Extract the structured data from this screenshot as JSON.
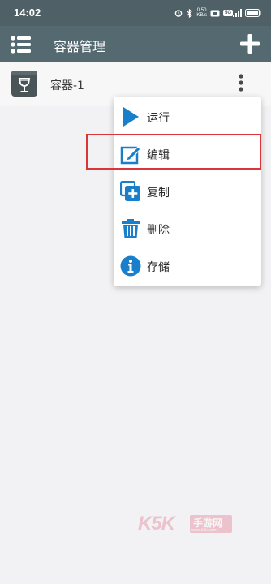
{
  "status_bar": {
    "time": "14:02",
    "net_speed_value": "0.50",
    "net_speed_unit": "KB/s",
    "network_badge": "5G"
  },
  "app_bar": {
    "title": "容器管理",
    "menu_icon": "hamburger-list-icon",
    "add_icon": "plus-icon"
  },
  "containers": [
    {
      "name": "容器-1",
      "icon": "wine-glass-box-icon"
    }
  ],
  "context_menu": {
    "items": [
      {
        "label": "运行",
        "icon": "play-icon",
        "color": "#1a7fcb"
      },
      {
        "label": "编辑",
        "icon": "edit-pencil-icon",
        "color": "#1a7fcb"
      },
      {
        "label": "复制",
        "icon": "copy-plus-icon",
        "color": "#1a7fcb"
      },
      {
        "label": "删除",
        "icon": "trash-icon",
        "color": "#1a7fcb"
      },
      {
        "label": "存储",
        "icon": "info-circle-icon",
        "color": "#1a7fcb"
      }
    ],
    "highlighted_index": 1
  },
  "watermark": {
    "brand": "K5K",
    "text": "手游网",
    "url": "www.k5k.com"
  },
  "colors": {
    "app_bar": "#546a70",
    "status_bar": "#4f6166",
    "accent": "#1a7fcb",
    "highlight": "#d8363a"
  }
}
